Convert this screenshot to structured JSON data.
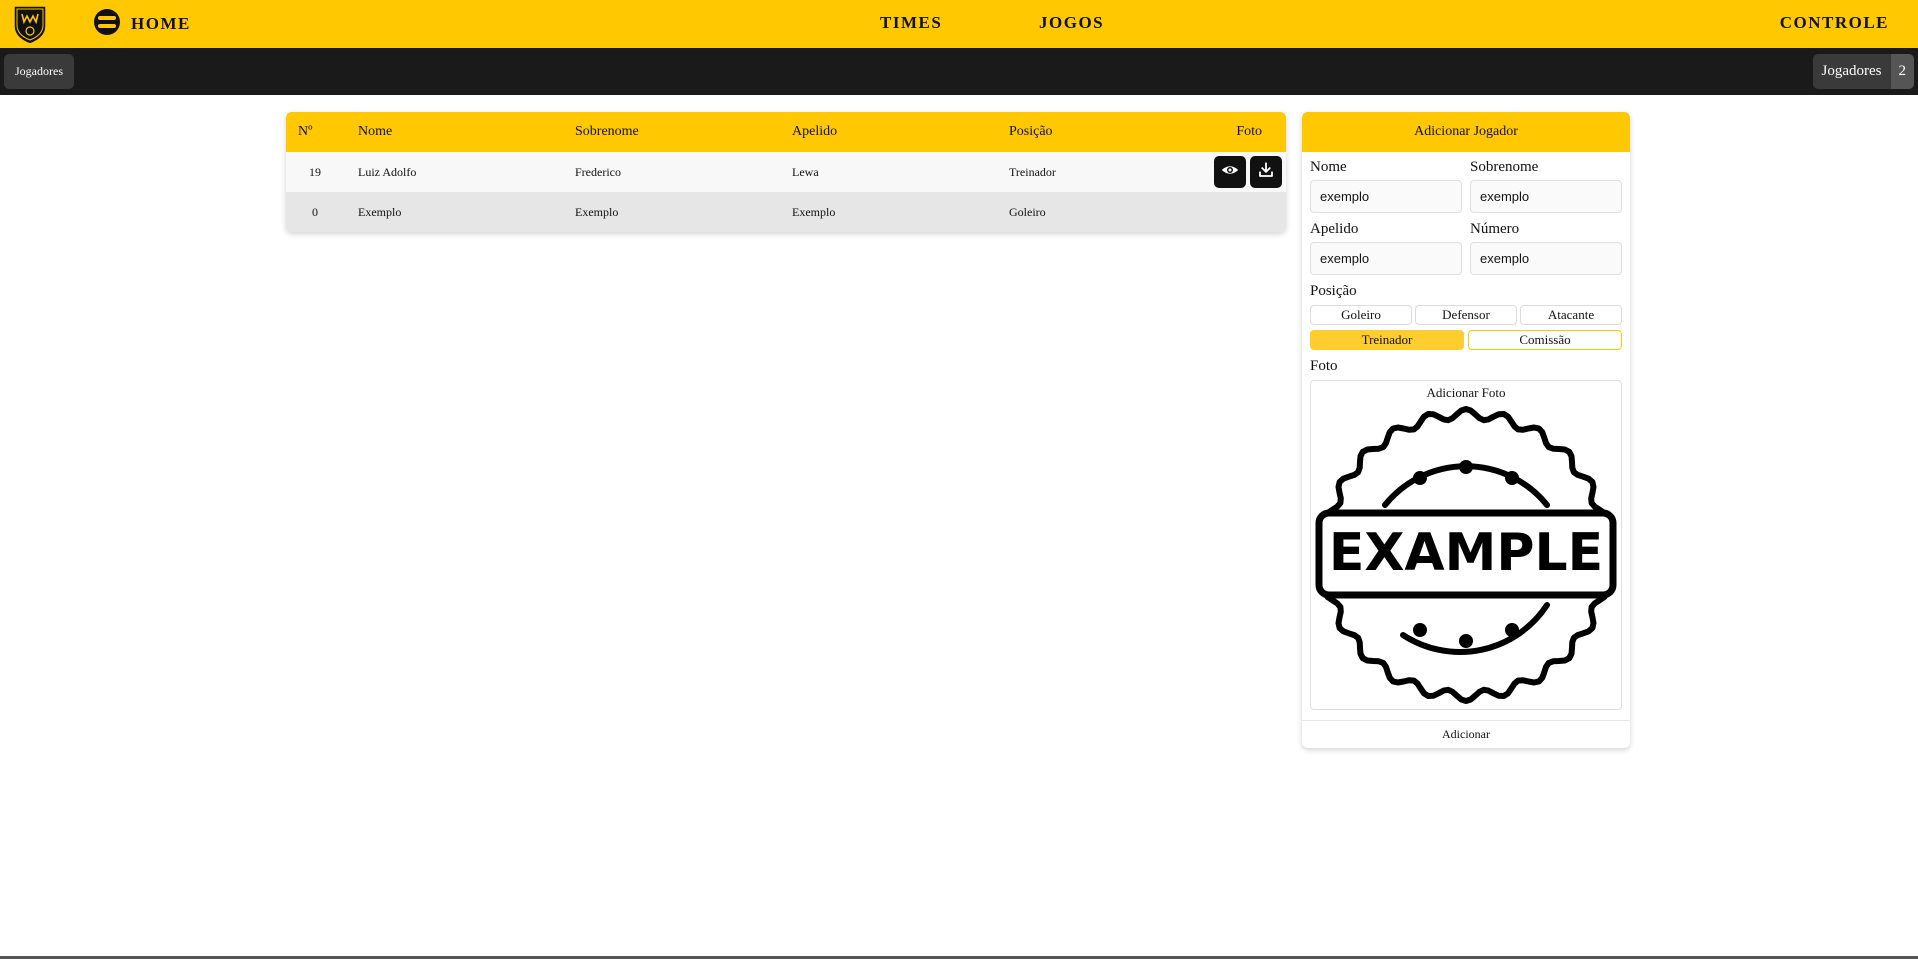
{
  "nav": {
    "home": "HOME",
    "times": "TIMES",
    "jogos": "JOGOS",
    "controle": "CONTROLE"
  },
  "subbar": {
    "button": "Jogadores",
    "count_label": "Jogadores",
    "count_value": "2"
  },
  "table": {
    "headers": [
      "Nº",
      "Nome",
      "Sobrenome",
      "Apelido",
      "Posição",
      "Foto"
    ],
    "rows": [
      {
        "num": "19",
        "nome": "Luiz Adolfo",
        "sobrenome": "Frederico",
        "apelido": "Lewa",
        "posicao": "Treinador",
        "has_foto": true
      },
      {
        "num": "0",
        "nome": "Exemplo",
        "sobrenome": "Exemplo",
        "apelido": "Exemplo",
        "posicao": "Goleiro",
        "has_foto": false
      }
    ]
  },
  "form": {
    "title": "Adicionar Jogador",
    "nome_label": "Nome",
    "nome_value": "exemplo",
    "sobrenome_label": "Sobrenome",
    "sobrenome_value": "exemplo",
    "apelido_label": "Apelido",
    "apelido_value": "exemplo",
    "numero_label": "Número",
    "numero_value": "exemplo",
    "posicao_label": "Posição",
    "posicoes": [
      "Goleiro",
      "Defensor",
      "Atacante",
      "Treinador",
      "Comissão"
    ],
    "selected_posicao": "Treinador",
    "foto_label": "Foto",
    "add_photo": "Adicionar Foto",
    "stamp_text": "EXAMPLE",
    "submit": "Adicionar"
  },
  "colors": {
    "accent": "#ffc800",
    "dark_bar": "#1a1a1a",
    "selected": "#ffcd2e"
  },
  "icons": {
    "logo": "club-crest-logo",
    "home": "stacked-layers-icon",
    "view": "eye-icon",
    "download": "download-icon"
  }
}
